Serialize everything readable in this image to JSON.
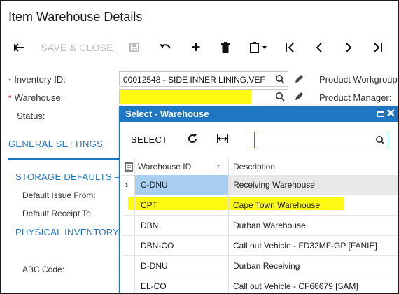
{
  "window": {
    "title": "Item Warehouse Details"
  },
  "toolbar": {
    "save_close_label": "SAVE & CLOSE"
  },
  "form": {
    "inventory_id": {
      "label": "Inventory ID:",
      "value": "00012548 - SIDE INNER LINING,VEF",
      "required": true
    },
    "warehouse": {
      "label": "Warehouse:",
      "value": "",
      "required": true
    },
    "status": {
      "label": "Status:"
    },
    "product_workgroup_label": "Product Workgroup",
    "product_manager_label": "Product Manager:"
  },
  "tabs": {
    "general_settings": "GENERAL SETTINGS"
  },
  "sections": {
    "storage_defaults": "STORAGE DEFAULTS —",
    "default_issue_from": "Default Issue From:",
    "default_receipt_to": "Default Receipt To:",
    "physical_inventory": "PHYSICAL INVENTORY",
    "abc_code": "ABC Code:"
  },
  "lookup": {
    "title": "Select - Warehouse",
    "select_label": "SELECT",
    "search_value": "",
    "columns": {
      "warehouse_id": "Warehouse ID",
      "description": "Description",
      "sort_indicator": "↑"
    },
    "rows": [
      {
        "id": "C-DNU",
        "desc": "Receiving Warehouse"
      },
      {
        "id": "CPT",
        "desc": "Cape Town Warehouse"
      },
      {
        "id": "DBN",
        "desc": "Durban Warehouse"
      },
      {
        "id": "DBN-CO",
        "desc": "Call out Vehicle - FD32MF-GP [FANIE]"
      },
      {
        "id": "D-DNU",
        "desc": "Durban Receiving"
      },
      {
        "id": "EL-CO",
        "desc": "Call out Vehicle - CF66679 [SAM]"
      }
    ],
    "selected_row": 0,
    "highlighted_row": 1
  },
  "colors": {
    "accent": "#1f77c4",
    "highlight": "#fffa12",
    "selected": "#a9cff0",
    "required": "#c62828"
  }
}
